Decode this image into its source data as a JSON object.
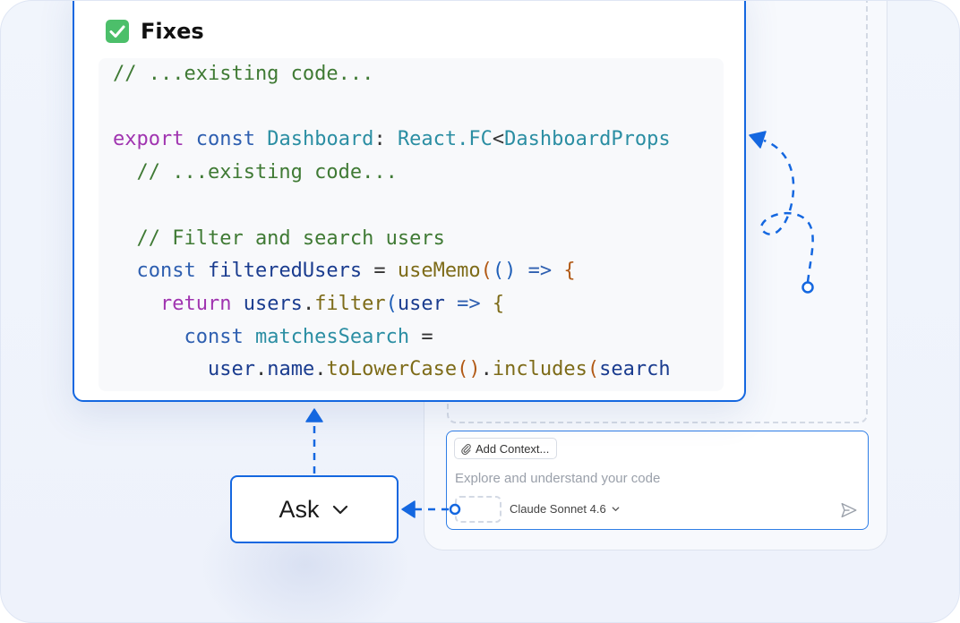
{
  "code_card": {
    "title": "Fixes",
    "check_icon": "check-mark-icon"
  },
  "code_lines": [
    {
      "parts": [
        {
          "t": "// ...existing code...",
          "c": "c-com"
        }
      ]
    },
    {
      "parts": []
    },
    {
      "parts": [
        {
          "t": "export",
          "c": "c-kw"
        },
        {
          "t": " ",
          "c": "c-pu"
        },
        {
          "t": "const",
          "c": "c-st"
        },
        {
          "t": " ",
          "c": "c-pu"
        },
        {
          "t": "Dashboard",
          "c": "c-ty"
        },
        {
          "t": ": ",
          "c": "c-pu"
        },
        {
          "t": "React.FC",
          "c": "c-ty"
        },
        {
          "t": "<",
          "c": "c-pu"
        },
        {
          "t": "DashboardProps",
          "c": "c-ty"
        }
      ]
    },
    {
      "parts": [
        {
          "t": "  // ...existing code...",
          "c": "c-com"
        }
      ]
    },
    {
      "parts": []
    },
    {
      "parts": [
        {
          "t": "  // Filter and search users",
          "c": "c-com"
        }
      ]
    },
    {
      "parts": [
        {
          "t": "  const",
          "c": "c-st"
        },
        {
          "t": " ",
          "c": "c-pu"
        },
        {
          "t": "filteredUsers",
          "c": "c-id"
        },
        {
          "t": " = ",
          "c": "c-pu"
        },
        {
          "t": "useMemo",
          "c": "c-fn"
        },
        {
          "t": "(",
          "c": "c-pa"
        },
        {
          "t": "()",
          "c": "c-pb"
        },
        {
          "t": " ",
          "c": "c-pu"
        },
        {
          "t": "=>",
          "c": "c-st"
        },
        {
          "t": " ",
          "c": "c-pu"
        },
        {
          "t": "{",
          "c": "c-pa"
        }
      ]
    },
    {
      "parts": [
        {
          "t": "    return",
          "c": "c-kw"
        },
        {
          "t": " ",
          "c": "c-pu"
        },
        {
          "t": "users",
          "c": "c-id"
        },
        {
          "t": ".",
          "c": "c-pu"
        },
        {
          "t": "filter",
          "c": "c-fn"
        },
        {
          "t": "(",
          "c": "c-pb"
        },
        {
          "t": "user",
          "c": "c-id"
        },
        {
          "t": " ",
          "c": "c-pu"
        },
        {
          "t": "=>",
          "c": "c-st"
        },
        {
          "t": " ",
          "c": "c-pu"
        },
        {
          "t": "{",
          "c": "c-fn"
        }
      ]
    },
    {
      "parts": [
        {
          "t": "      const",
          "c": "c-st"
        },
        {
          "t": " ",
          "c": "c-pu"
        },
        {
          "t": "matchesSearch",
          "c": "c-ty"
        },
        {
          "t": " =",
          "c": "c-pu"
        }
      ]
    },
    {
      "parts": [
        {
          "t": "        user",
          "c": "c-id"
        },
        {
          "t": ".",
          "c": "c-pu"
        },
        {
          "t": "name",
          "c": "c-id"
        },
        {
          "t": ".",
          "c": "c-pu"
        },
        {
          "t": "toLowerCase",
          "c": "c-fn"
        },
        {
          "t": "()",
          "c": "c-pa"
        },
        {
          "t": ".",
          "c": "c-pu"
        },
        {
          "t": "includes",
          "c": "c-fn"
        },
        {
          "t": "(",
          "c": "c-pa"
        },
        {
          "t": "search",
          "c": "c-id"
        }
      ]
    }
  ],
  "chat": {
    "add_context_label": "Add Context...",
    "add_context_icon": "paperclip-icon",
    "input_placeholder": "Explore and understand your code",
    "model_label": "Claude Sonnet 4.6",
    "model_chevron_icon": "chevron-down-icon",
    "send_icon": "send-icon"
  },
  "ask_button": {
    "label": "Ask",
    "icon": "chevron-down-icon"
  },
  "colors": {
    "accent": "#1467e0",
    "input_border": "#2f7ee6",
    "comment": "#3f7a34",
    "keyword": "#a034b0",
    "storage": "#2e5fb0",
    "type": "#2b8ea3",
    "function": "#7d6b18"
  }
}
